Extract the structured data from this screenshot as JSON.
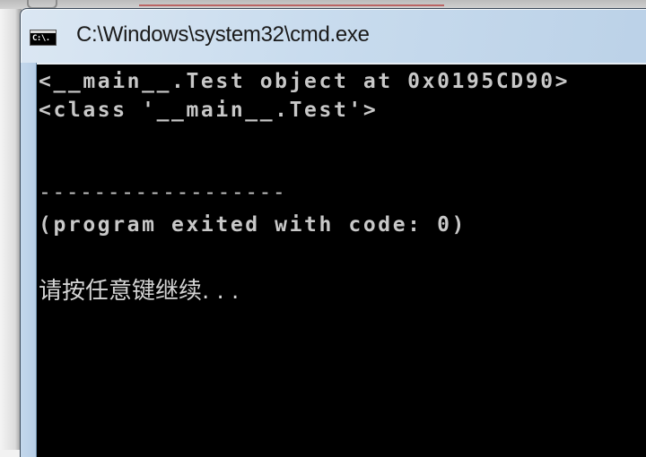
{
  "window": {
    "title": "C:\\Windows\\system32\\cmd.exe",
    "icon": "cmd-console-icon",
    "icon_glyph": "C:\\."
  },
  "console": {
    "lines": [
      "<__main__.Test object at 0x0195CD90>",
      "<class '__main__.Test'>",
      "------------------",
      "(program exited with code: 0)",
      "请按任意键继续. . ."
    ]
  },
  "colors": {
    "console_background": "#000000",
    "console_text": "#c8c8c8",
    "titlebar": "#c9dcee"
  }
}
